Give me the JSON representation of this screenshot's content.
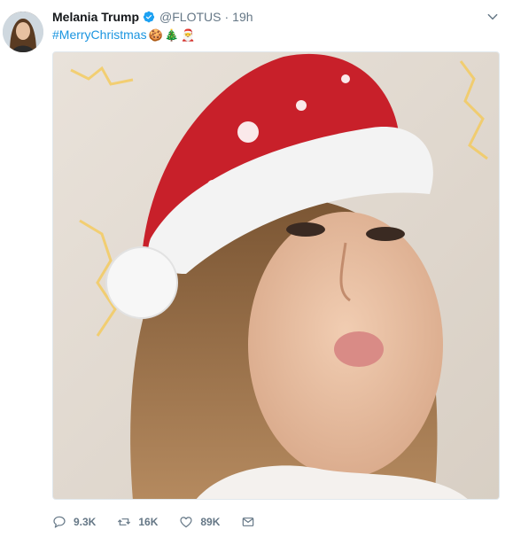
{
  "tweet": {
    "display_name": "Melania Trump",
    "handle": "@FLOTUS",
    "separator": "·",
    "timestamp": "19h",
    "hashtag": "#MerryChristmas",
    "emojis": [
      "🍪",
      "🎄",
      "🎅"
    ],
    "verified": true
  },
  "actions": {
    "reply_count": "9.3K",
    "retweet_count": "16K",
    "like_count": "89K"
  },
  "icons": {
    "verified": "verified-badge-icon",
    "caret": "chevron-down-icon",
    "reply": "reply-icon",
    "retweet": "retweet-icon",
    "like": "heart-icon",
    "share": "envelope-icon"
  },
  "colors": {
    "link": "#1b95e0",
    "muted": "#657786",
    "verified": "#1da1f2"
  }
}
